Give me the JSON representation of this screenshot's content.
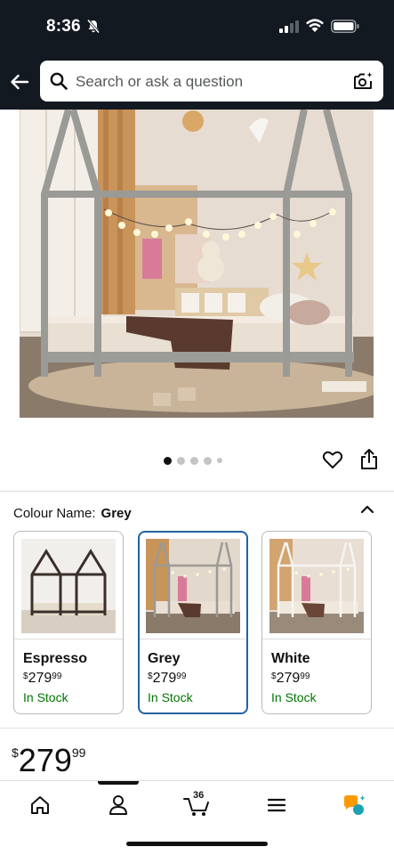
{
  "status_bar": {
    "time": "8:36"
  },
  "search": {
    "placeholder": "Search or ask a question"
  },
  "gallery": {
    "image_count": 5,
    "active_index": 0,
    "image_alt": "Grey house-shaped floor bed in a children's room"
  },
  "colour": {
    "label": "Colour Name:",
    "selected": "Grey",
    "options": [
      {
        "name": "Espresso",
        "currency": "$",
        "price_whole": "279",
        "price_fraction": "99",
        "stock": "In Stock",
        "frame_color": "#3a2f2a"
      },
      {
        "name": "Grey",
        "currency": "$",
        "price_whole": "279",
        "price_fraction": "99",
        "stock": "In Stock",
        "frame_color": "#9a9a96"
      },
      {
        "name": "White",
        "currency": "$",
        "price_whole": "279",
        "price_fraction": "99",
        "stock": "In Stock",
        "frame_color": "#eeeeea"
      }
    ]
  },
  "price": {
    "currency": "$",
    "whole": "279",
    "fraction": "99"
  },
  "bottom_nav": {
    "items": [
      "home-icon",
      "account-icon",
      "cart-icon",
      "menu-icon",
      "rufus-icon"
    ],
    "cart_count": "36"
  },
  "colors": {
    "header_bg": "#131921",
    "selected_border": "#2162a1",
    "in_stock": "#007600",
    "rufus_orange": "#ff9900",
    "rufus_teal": "#1ba1b3"
  }
}
